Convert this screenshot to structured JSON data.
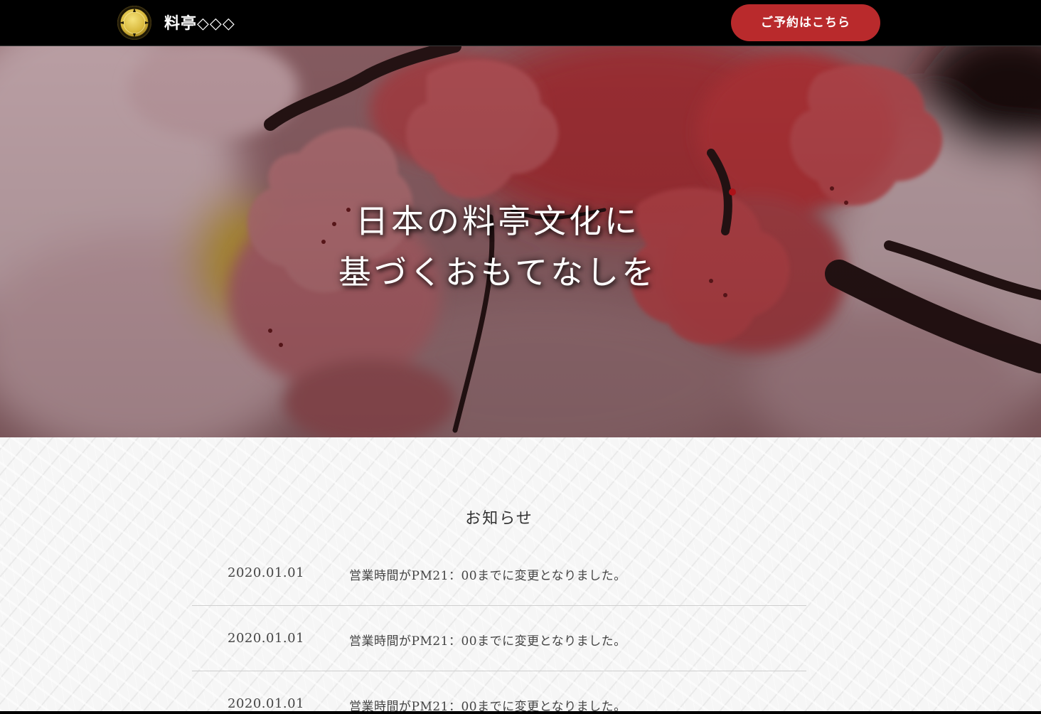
{
  "header": {
    "logo_text": "料亭◇◇◇",
    "reserve_label": "ご予約はこちら"
  },
  "hero": {
    "line1": "日本の料亭文化に",
    "line2": "基づくおもてなしを"
  },
  "news": {
    "title": "お知らせ",
    "items": [
      {
        "date": "2020.01.01",
        "text": "営業時間がPM21：00までに変更となりました。"
      },
      {
        "date": "2020.01.01",
        "text": "営業時間がPM21：00までに変更となりました。"
      },
      {
        "date": "2020.01.01",
        "text": "営業時間がPM21：00までに変更となりました。"
      }
    ]
  },
  "colors": {
    "header_bg": "#000000",
    "accent_button": "#b92a2c",
    "emblem_gold": "#d8b83c",
    "text_dark": "#444444"
  },
  "icons": {
    "logo": "family-crest-icon"
  }
}
